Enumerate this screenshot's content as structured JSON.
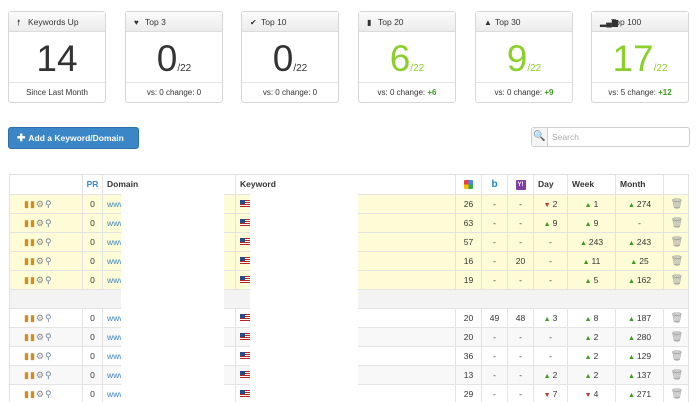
{
  "cards": [
    {
      "title": "Keywords Up",
      "icon": "arrow-up-icon",
      "glyph": "🠕",
      "value": "14",
      "denominator": "",
      "footer": "Since Last Month",
      "change": "",
      "green": false
    },
    {
      "title": "Top 3",
      "icon": "heart-icon",
      "glyph": "♥",
      "value": "0",
      "denominator": "/22",
      "footer": "vs: 0 change: 0",
      "change": "",
      "green": false
    },
    {
      "title": "Top 10",
      "icon": "check-icon",
      "glyph": "✔",
      "value": "0",
      "denominator": "/22",
      "footer": "vs: 0 change: 0",
      "change": "",
      "green": false
    },
    {
      "title": "Top 20",
      "icon": "bookmark-icon",
      "glyph": "▮",
      "value": "6",
      "denominator": "/22",
      "footer": "vs: 0 change: ",
      "change": "+6",
      "green": true
    },
    {
      "title": "Top 30",
      "icon": "road-icon",
      "glyph": "▲",
      "value": "9",
      "denominator": "/22",
      "footer": "vs: 0 change: ",
      "change": "+9",
      "green": true
    },
    {
      "title": "Top 100",
      "icon": "signal-icon",
      "glyph": "▂▄▆",
      "value": "17",
      "denominator": "/22",
      "footer": "vs: 5 change: ",
      "change": "+12",
      "green": true
    }
  ],
  "add_button": {
    "label": "Add a Keyword/Domain",
    "glyph": "✚"
  },
  "search": {
    "placeholder": "Search",
    "glyph": "🔍"
  },
  "table": {
    "headers": {
      "pr": "PR",
      "domain": "Domain",
      "keyword": "Keyword",
      "day": "Day",
      "week": "Week",
      "month": "Month"
    },
    "groups": [
      {
        "style": "yellow",
        "rows": [
          {
            "pr": "0",
            "domain": "www",
            "google": "26",
            "bing": "-",
            "yahoo": "-",
            "day": "2",
            "day_dir": "down",
            "week": "1",
            "week_dir": "up",
            "month": "274",
            "month_dir": "up"
          },
          {
            "pr": "0",
            "domain": "www",
            "google": "63",
            "bing": "-",
            "yahoo": "-",
            "day": "9",
            "day_dir": "up",
            "week": "9",
            "week_dir": "up",
            "month": "-",
            "month_dir": ""
          },
          {
            "pr": "0",
            "domain": "www",
            "google": "57",
            "bing": "-",
            "yahoo": "-",
            "day": "-",
            "day_dir": "",
            "week": "243",
            "week_dir": "up",
            "month": "243",
            "month_dir": "up"
          },
          {
            "pr": "0",
            "domain": "www",
            "google": "16",
            "bing": "-",
            "yahoo": "20",
            "day": "-",
            "day_dir": "",
            "week": "11",
            "week_dir": "up",
            "month": "25",
            "month_dir": "up"
          },
          {
            "pr": "0",
            "domain": "www",
            "google": "19",
            "bing": "-",
            "yahoo": "-",
            "day": "-",
            "day_dir": "",
            "week": "5",
            "week_dir": "up",
            "month": "162",
            "month_dir": "up"
          }
        ]
      },
      {
        "style": "white",
        "rows": [
          {
            "pr": "0",
            "domain": "www",
            "google": "20",
            "bing": "49",
            "yahoo": "48",
            "day": "3",
            "day_dir": "up",
            "week": "8",
            "week_dir": "up",
            "month": "187",
            "month_dir": "up"
          },
          {
            "pr": "0",
            "domain": "www",
            "google": "20",
            "bing": "-",
            "yahoo": "-",
            "day": "-",
            "day_dir": "",
            "week": "2",
            "week_dir": "up",
            "month": "280",
            "month_dir": "up"
          },
          {
            "pr": "0",
            "domain": "www",
            "google": "36",
            "bing": "-",
            "yahoo": "-",
            "day": "-",
            "day_dir": "",
            "week": "2",
            "week_dir": "up",
            "month": "129",
            "month_dir": "up"
          },
          {
            "pr": "0",
            "domain": "www",
            "google": "13",
            "bing": "-",
            "yahoo": "-",
            "day": "2",
            "day_dir": "up",
            "week": "2",
            "week_dir": "up",
            "month": "137",
            "month_dir": "up"
          },
          {
            "pr": "0",
            "domain": "www",
            "google": "29",
            "bing": "-",
            "yahoo": "-",
            "day": "7",
            "day_dir": "down",
            "week": "4",
            "week_dir": "down",
            "month": "271",
            "month_dir": "up"
          }
        ]
      }
    ]
  },
  "colors": {
    "accent": "#3a86c6",
    "positive": "#8bcf2c",
    "change_positive": "#3a9b1d",
    "negative": "#c0392b",
    "highlight_row": "#fdfcd6"
  }
}
